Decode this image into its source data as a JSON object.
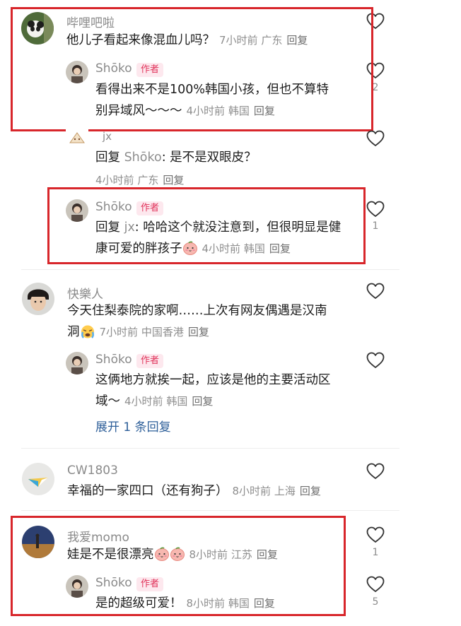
{
  "comments": [
    {
      "user": "哔哩吧啦",
      "text": "他儿子看起来像混血儿吗？",
      "time": "7小时前",
      "location": "广东",
      "reply_label": "回复",
      "likes": "",
      "replies": [
        {
          "user": "Shōko",
          "badge": "作者",
          "text_line1": "看得出来不是100%韩国小孩，但也不算特",
          "text_line2": "别异域风～～～",
          "time": "4小时前",
          "location": "韩国",
          "reply_label": "回复",
          "likes": "2"
        },
        {
          "user": "jx",
          "prefix": "回复",
          "mention": "Shōko",
          "text": ": 是不是双眼皮？",
          "time": "4小时前",
          "location": "广东",
          "reply_label": "回复"
        },
        {
          "user": "Shōko",
          "badge": "作者",
          "prefix": "回复",
          "mention": "jx",
          "text_line1": ": 哈哈这个就没注意到，但很明显是健",
          "text_line2": "康可爱的胖孩子",
          "time": "4小时前",
          "location": "韩国",
          "reply_label": "回复",
          "likes": "1"
        }
      ]
    },
    {
      "user": "快樂人",
      "text_line1": "今天住梨泰院的家啊……上次有网友偶遇是汉南",
      "text_line2": "洞",
      "time": "7小时前",
      "location": "中国香港",
      "reply_label": "回复",
      "replies": [
        {
          "user": "Shōko",
          "badge": "作者",
          "text_line1": "这俩地方就挨一起，应该是他的主要活动区",
          "text_line2": "域～",
          "time": "4小时前",
          "location": "韩国",
          "reply_label": "回复"
        }
      ],
      "expand_label": "展开 1 条回复"
    },
    {
      "user": "CW1803",
      "text": "幸福的一家四口（还有狗子）",
      "time": "8小时前",
      "location": "上海",
      "reply_label": "回复"
    },
    {
      "user": "我爱momo",
      "text": "娃是不是很漂亮",
      "time": "8小时前",
      "location": "江苏",
      "reply_label": "回复",
      "likes": "1",
      "replies": [
        {
          "user": "Shōko",
          "badge": "作者",
          "text": "是的超级可爱！",
          "time": "8小时前",
          "location": "韩国",
          "reply_label": "回复",
          "likes": "5"
        }
      ]
    }
  ],
  "icons": {
    "like": "heart-outline-icon",
    "emoji_blush": "peach-face-emoji",
    "emoji_cry": "crying-face-emoji"
  },
  "colors": {
    "highlight_box": "#d8262b",
    "author_badge_text": "#e0335a",
    "author_badge_bg": "#fde8ee",
    "expand_link": "#2e5f99"
  }
}
